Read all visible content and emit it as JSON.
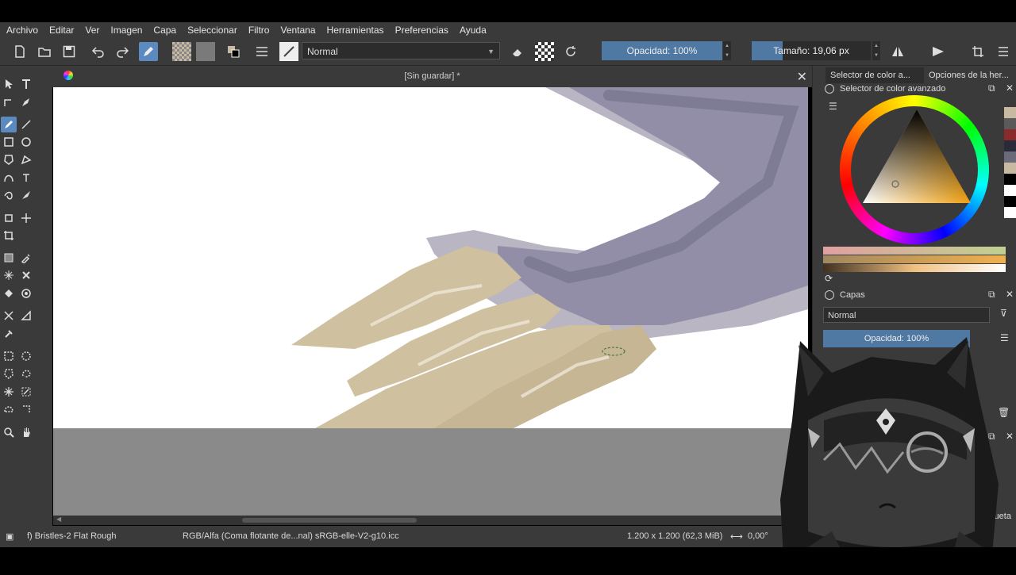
{
  "menu": [
    "Archivo",
    "Editar",
    "Ver",
    "Imagen",
    "Capa",
    "Seleccionar",
    "Filtro",
    "Ventana",
    "Herramientas",
    "Preferencias",
    "Ayuda"
  ],
  "toolbar": {
    "blend_mode": "Normal",
    "opacity_label": "Opacidad: 100%",
    "opacity_value": 100,
    "size_label": "Tamaño: 19,06 px"
  },
  "document": {
    "title": "[Sin guardar]  *"
  },
  "dock": {
    "tab_color": "Selector de color a...",
    "tab_options": "Opciones de la her...",
    "color_panel_title": "Selector de color avanzado",
    "layers_title": "Capas",
    "layers_blend": "Normal",
    "layers_opacity": "Opacidad:  100%",
    "partial_label": "iqueta",
    "swatches": [
      "#c9b9a0",
      "#5a5a5a",
      "#8a2a2a",
      "#2a2a3a",
      "#6a6a7a",
      "#c9b9a0",
      "#000000",
      "#ffffff",
      "#000000",
      "#ffffff"
    ]
  },
  "status": {
    "brush": "f) Bristles-2 Flat Rough",
    "color_space": "RGB/Alfa (Coma flotante de...nal)  sRGB-elle-V2-g10.icc",
    "dimensions": "1.200 x 1.200 (62,3 MiB)",
    "rotation": "0,00°"
  },
  "colors": {
    "accent": "#5a8ac0",
    "slider_fill": "#4f78a3",
    "panel_bg": "#3a3a3a",
    "canvas_paint_skin": "#cfc0a0",
    "canvas_paint_purple": "#8a86a0"
  }
}
